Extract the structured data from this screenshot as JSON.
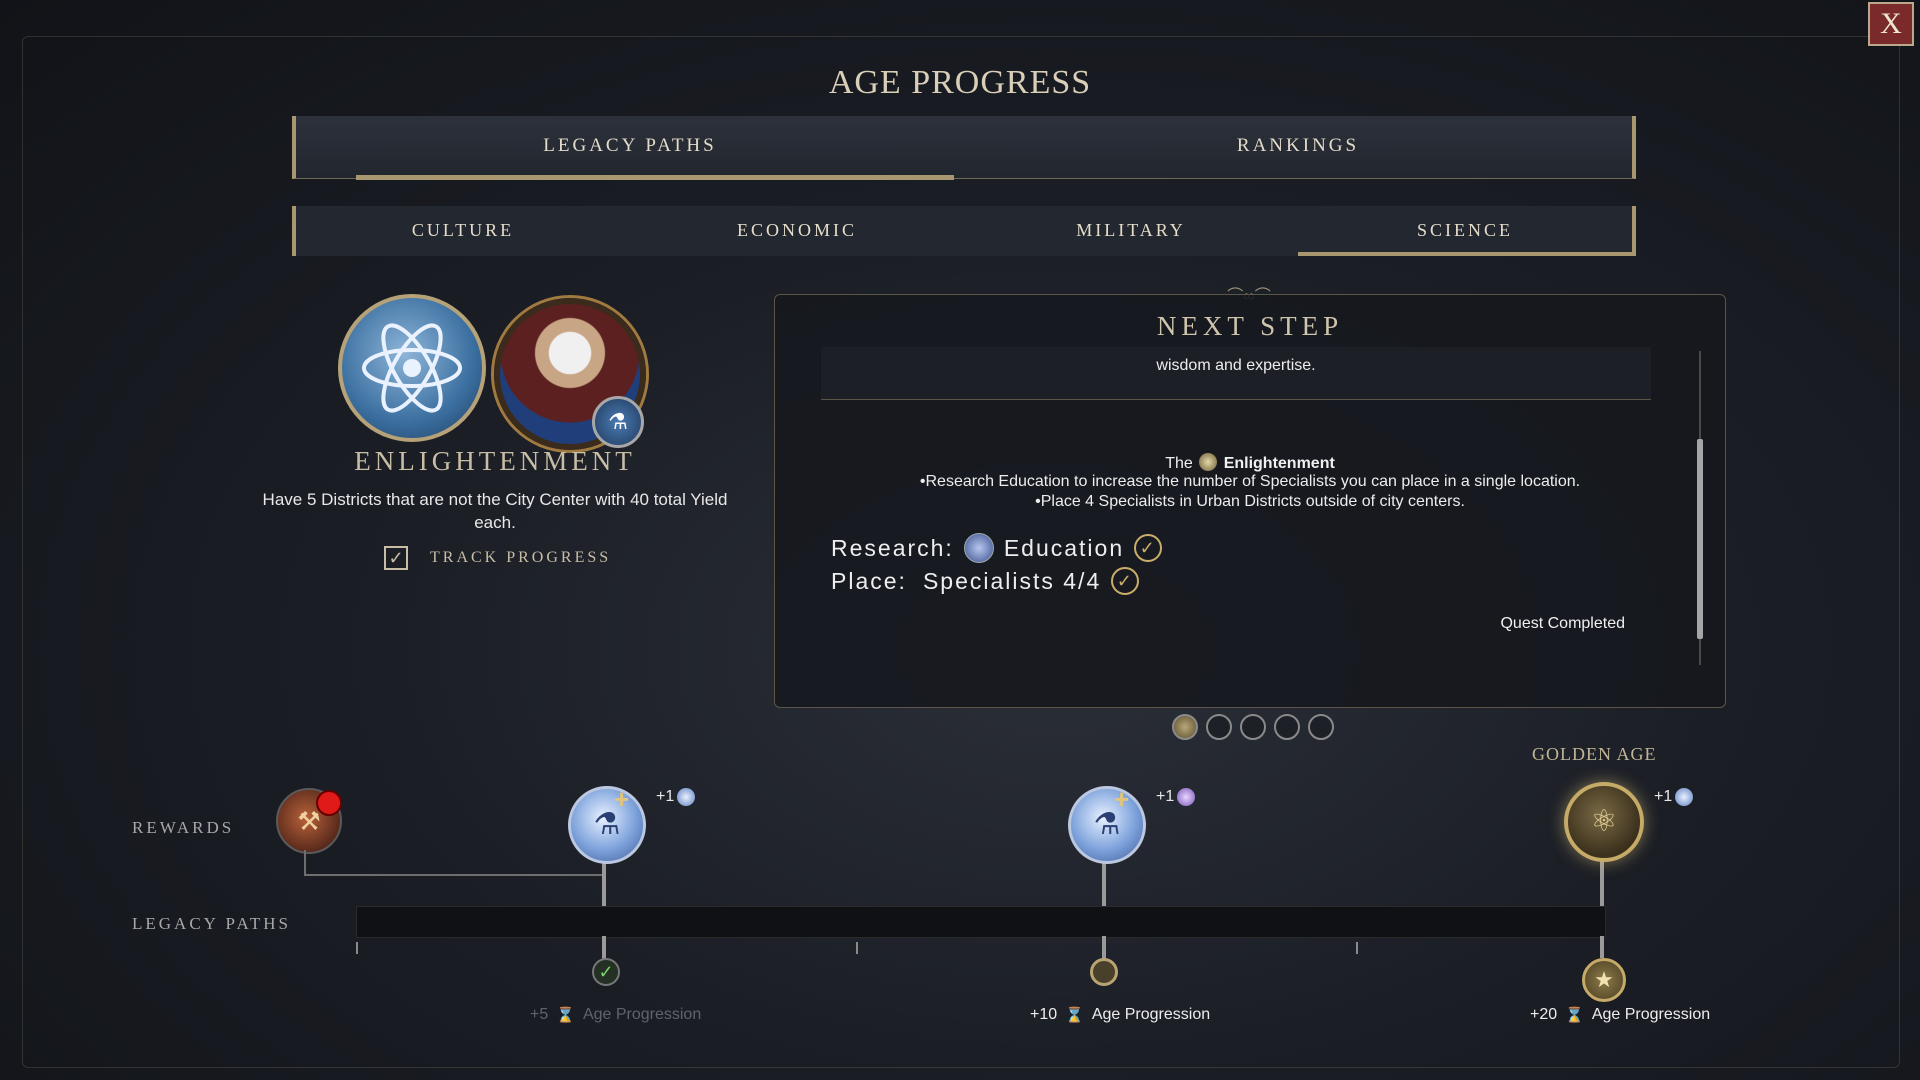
{
  "window": {
    "title": "AGE PROGRESS",
    "close_label": "X"
  },
  "main_tabs": [
    {
      "label": "LEGACY PATHS",
      "active": true
    },
    {
      "label": "RANKINGS",
      "active": false
    }
  ],
  "sub_tabs": [
    {
      "label": "CULTURE",
      "active": false
    },
    {
      "label": "ECONOMIC",
      "active": false
    },
    {
      "label": "MILITARY",
      "active": false
    },
    {
      "label": "SCIENCE",
      "active": true
    }
  ],
  "legacy": {
    "emblem_icon": "atom-icon",
    "leader_badge_icon": "flask-icon",
    "title": "ENLIGHTENMENT",
    "description": "Have 5 Districts that are not the City Center with 40 total Yield each.",
    "track_checked": true,
    "track_label": "TRACK PROGRESS"
  },
  "next_step": {
    "title": "NEXT STEP",
    "subtitle": "wisdom and expertise.",
    "quest_prefix": "The",
    "quest_name": "Enlightenment",
    "lines": [
      "•Research Education to increase the number of Specialists you can place in a single location.",
      "•Place 4 Specialists in Urban Districts outside of city centers."
    ],
    "requirements": [
      {
        "label": "Research:",
        "value": "Education",
        "icon": "tech-icon",
        "completed": true
      },
      {
        "label": "Place:",
        "value": "Specialists 4/4",
        "completed": true
      }
    ],
    "status": "Quest Completed"
  },
  "pager": {
    "count": 5,
    "active_index": 0
  },
  "timeline": {
    "rewards_label": "REWARDS",
    "legacy_paths_label": "LEGACY PATHS",
    "golden_age_label": "GOLDEN AGE",
    "milestones": [
      {
        "reward_badge": "+1",
        "badge_icon": "science-icon",
        "progression_value": "+5",
        "progression_label": "Age Progression",
        "state": "completed"
      },
      {
        "reward_badge": "+1",
        "badge_icon": "codex-icon",
        "progression_value": "+10",
        "progression_label": "Age Progression",
        "state": "pending"
      },
      {
        "reward_badge": "+1",
        "badge_icon": "science-icon",
        "progression_value": "+20",
        "progression_label": "Age Progression",
        "state": "golden"
      }
    ]
  },
  "colors": {
    "accent_gold": "#a8976f",
    "background": "#1b1e25",
    "close_red": "#7a2a2a",
    "science_blue": "#7da2db"
  }
}
